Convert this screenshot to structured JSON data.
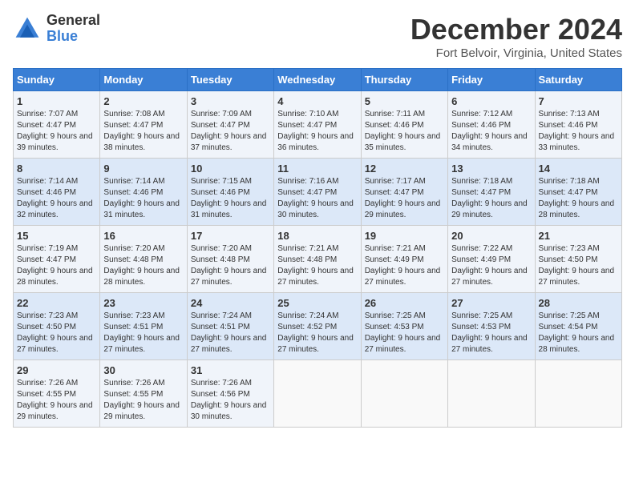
{
  "logo": {
    "general": "General",
    "blue": "Blue"
  },
  "title": "December 2024",
  "location": "Fort Belvoir, Virginia, United States",
  "weekdays": [
    "Sunday",
    "Monday",
    "Tuesday",
    "Wednesday",
    "Thursday",
    "Friday",
    "Saturday"
  ],
  "weeks": [
    [
      {
        "day": "1",
        "sunrise": "Sunrise: 7:07 AM",
        "sunset": "Sunset: 4:47 PM",
        "daylight": "Daylight: 9 hours and 39 minutes."
      },
      {
        "day": "2",
        "sunrise": "Sunrise: 7:08 AM",
        "sunset": "Sunset: 4:47 PM",
        "daylight": "Daylight: 9 hours and 38 minutes."
      },
      {
        "day": "3",
        "sunrise": "Sunrise: 7:09 AM",
        "sunset": "Sunset: 4:47 PM",
        "daylight": "Daylight: 9 hours and 37 minutes."
      },
      {
        "day": "4",
        "sunrise": "Sunrise: 7:10 AM",
        "sunset": "Sunset: 4:47 PM",
        "daylight": "Daylight: 9 hours and 36 minutes."
      },
      {
        "day": "5",
        "sunrise": "Sunrise: 7:11 AM",
        "sunset": "Sunset: 4:46 PM",
        "daylight": "Daylight: 9 hours and 35 minutes."
      },
      {
        "day": "6",
        "sunrise": "Sunrise: 7:12 AM",
        "sunset": "Sunset: 4:46 PM",
        "daylight": "Daylight: 9 hours and 34 minutes."
      },
      {
        "day": "7",
        "sunrise": "Sunrise: 7:13 AM",
        "sunset": "Sunset: 4:46 PM",
        "daylight": "Daylight: 9 hours and 33 minutes."
      }
    ],
    [
      {
        "day": "8",
        "sunrise": "Sunrise: 7:14 AM",
        "sunset": "Sunset: 4:46 PM",
        "daylight": "Daylight: 9 hours and 32 minutes."
      },
      {
        "day": "9",
        "sunrise": "Sunrise: 7:14 AM",
        "sunset": "Sunset: 4:46 PM",
        "daylight": "Daylight: 9 hours and 31 minutes."
      },
      {
        "day": "10",
        "sunrise": "Sunrise: 7:15 AM",
        "sunset": "Sunset: 4:46 PM",
        "daylight": "Daylight: 9 hours and 31 minutes."
      },
      {
        "day": "11",
        "sunrise": "Sunrise: 7:16 AM",
        "sunset": "Sunset: 4:47 PM",
        "daylight": "Daylight: 9 hours and 30 minutes."
      },
      {
        "day": "12",
        "sunrise": "Sunrise: 7:17 AM",
        "sunset": "Sunset: 4:47 PM",
        "daylight": "Daylight: 9 hours and 29 minutes."
      },
      {
        "day": "13",
        "sunrise": "Sunrise: 7:18 AM",
        "sunset": "Sunset: 4:47 PM",
        "daylight": "Daylight: 9 hours and 29 minutes."
      },
      {
        "day": "14",
        "sunrise": "Sunrise: 7:18 AM",
        "sunset": "Sunset: 4:47 PM",
        "daylight": "Daylight: 9 hours and 28 minutes."
      }
    ],
    [
      {
        "day": "15",
        "sunrise": "Sunrise: 7:19 AM",
        "sunset": "Sunset: 4:47 PM",
        "daylight": "Daylight: 9 hours and 28 minutes."
      },
      {
        "day": "16",
        "sunrise": "Sunrise: 7:20 AM",
        "sunset": "Sunset: 4:48 PM",
        "daylight": "Daylight: 9 hours and 28 minutes."
      },
      {
        "day": "17",
        "sunrise": "Sunrise: 7:20 AM",
        "sunset": "Sunset: 4:48 PM",
        "daylight": "Daylight: 9 hours and 27 minutes."
      },
      {
        "day": "18",
        "sunrise": "Sunrise: 7:21 AM",
        "sunset": "Sunset: 4:48 PM",
        "daylight": "Daylight: 9 hours and 27 minutes."
      },
      {
        "day": "19",
        "sunrise": "Sunrise: 7:21 AM",
        "sunset": "Sunset: 4:49 PM",
        "daylight": "Daylight: 9 hours and 27 minutes."
      },
      {
        "day": "20",
        "sunrise": "Sunrise: 7:22 AM",
        "sunset": "Sunset: 4:49 PM",
        "daylight": "Daylight: 9 hours and 27 minutes."
      },
      {
        "day": "21",
        "sunrise": "Sunrise: 7:23 AM",
        "sunset": "Sunset: 4:50 PM",
        "daylight": "Daylight: 9 hours and 27 minutes."
      }
    ],
    [
      {
        "day": "22",
        "sunrise": "Sunrise: 7:23 AM",
        "sunset": "Sunset: 4:50 PM",
        "daylight": "Daylight: 9 hours and 27 minutes."
      },
      {
        "day": "23",
        "sunrise": "Sunrise: 7:23 AM",
        "sunset": "Sunset: 4:51 PM",
        "daylight": "Daylight: 9 hours and 27 minutes."
      },
      {
        "day": "24",
        "sunrise": "Sunrise: 7:24 AM",
        "sunset": "Sunset: 4:51 PM",
        "daylight": "Daylight: 9 hours and 27 minutes."
      },
      {
        "day": "25",
        "sunrise": "Sunrise: 7:24 AM",
        "sunset": "Sunset: 4:52 PM",
        "daylight": "Daylight: 9 hours and 27 minutes."
      },
      {
        "day": "26",
        "sunrise": "Sunrise: 7:25 AM",
        "sunset": "Sunset: 4:53 PM",
        "daylight": "Daylight: 9 hours and 27 minutes."
      },
      {
        "day": "27",
        "sunrise": "Sunrise: 7:25 AM",
        "sunset": "Sunset: 4:53 PM",
        "daylight": "Daylight: 9 hours and 27 minutes."
      },
      {
        "day": "28",
        "sunrise": "Sunrise: 7:25 AM",
        "sunset": "Sunset: 4:54 PM",
        "daylight": "Daylight: 9 hours and 28 minutes."
      }
    ],
    [
      {
        "day": "29",
        "sunrise": "Sunrise: 7:26 AM",
        "sunset": "Sunset: 4:55 PM",
        "daylight": "Daylight: 9 hours and 29 minutes."
      },
      {
        "day": "30",
        "sunrise": "Sunrise: 7:26 AM",
        "sunset": "Sunset: 4:55 PM",
        "daylight": "Daylight: 9 hours and 29 minutes."
      },
      {
        "day": "31",
        "sunrise": "Sunrise: 7:26 AM",
        "sunset": "Sunset: 4:56 PM",
        "daylight": "Daylight: 9 hours and 30 minutes."
      },
      null,
      null,
      null,
      null
    ]
  ]
}
